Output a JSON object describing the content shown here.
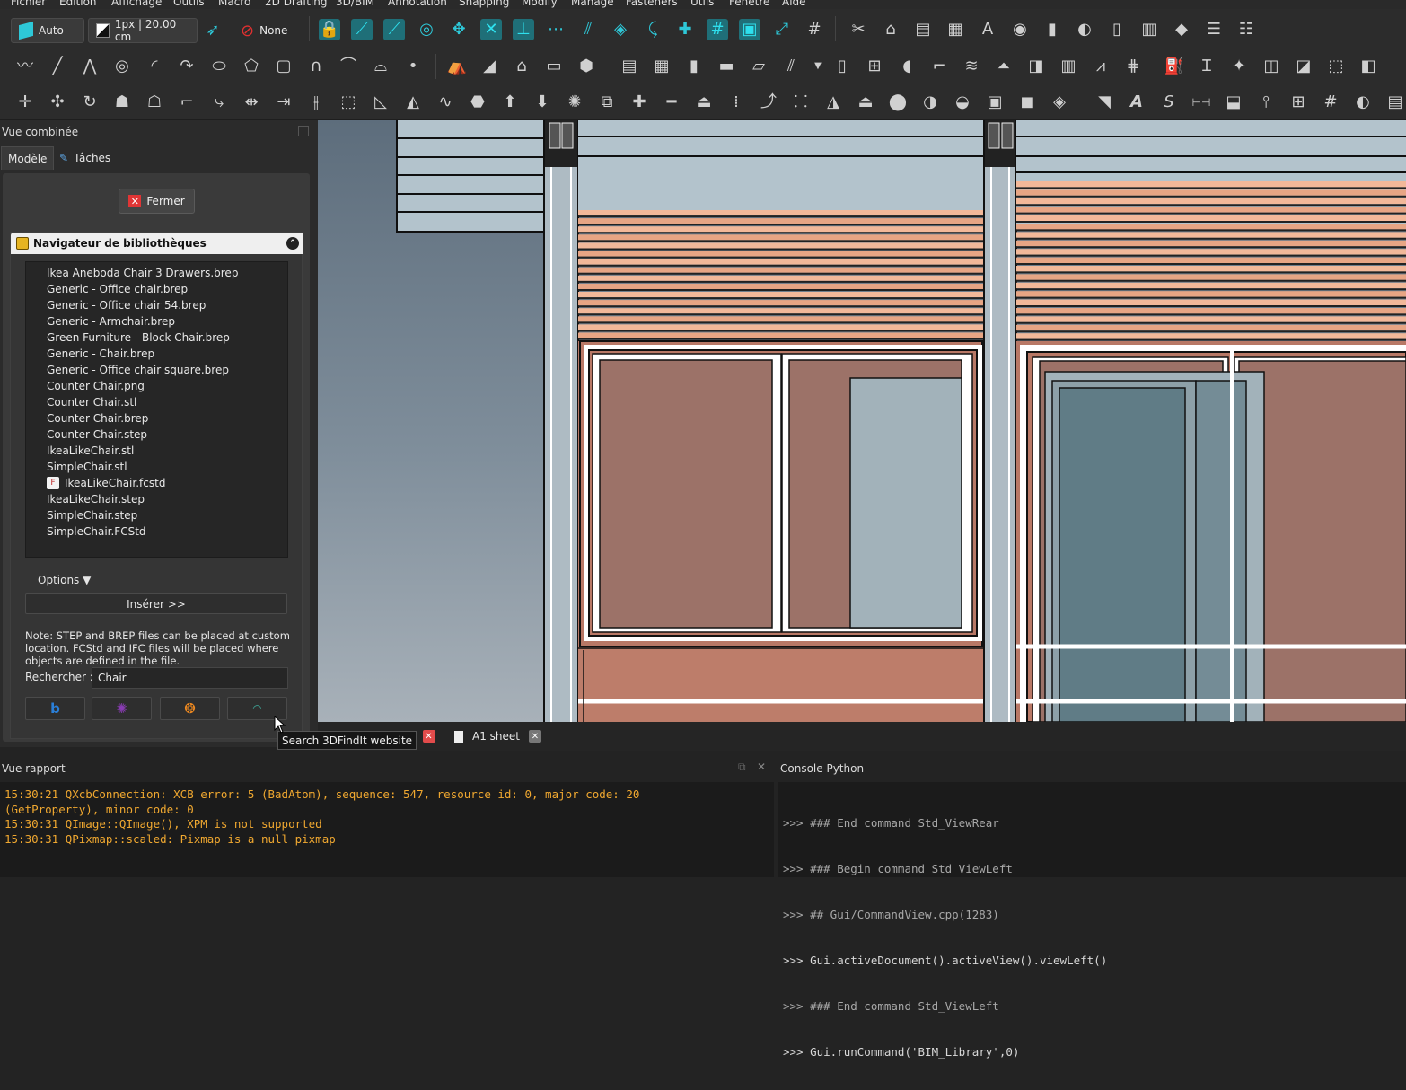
{
  "menu": [
    "Fichier",
    "Édition",
    "Affichage",
    "Outils",
    "Macro",
    "2D Drafting",
    "3D/BIM",
    "Annotation",
    "Snapping",
    "Modify",
    "Manage",
    "Fasteners",
    "Utils",
    "Fenêtre",
    "Aide"
  ],
  "toolbar": {
    "mode": "Auto",
    "line_style": "1px | 20.00 cm",
    "none_label": "None"
  },
  "left_panel": {
    "title": "Vue combinée",
    "tab_model": "Modèle",
    "tab_tasks": "Tâches",
    "close_label": "Fermer",
    "library_title": "Navigateur de bibliothèques",
    "files": [
      "Ikea Aneboda Chair 3 Drawers.brep",
      "Generic - Office chair.brep",
      "Generic - Office chair 54.brep",
      "Generic - Armchair.brep",
      "Green Furniture - Block Chair.brep",
      "Generic - Chair.brep",
      "Generic - Office chair square.brep",
      "Counter Chair.png",
      "Counter Chair.stl",
      "Counter Chair.brep",
      "Counter Chair.step",
      "IkeaLikeChair.stl",
      "SimpleChair.stl",
      "IkeaLikeChair.fcstd",
      "IkeaLikeChair.step",
      "SimpleChair.step",
      "SimpleChair.FCStd"
    ],
    "options_label": "Options ▼",
    "insert_label": "Insérer >>",
    "note": "Note: STEP and BREP files can be placed at custom location. FCStd and IFC files will be placed where objects are defined in the file.",
    "search_label": "Rechercher :",
    "search_value": "Chair"
  },
  "tooltip": "Search 3DFindIt website",
  "doc_tabs": [
    {
      "label": ": 1"
    },
    {
      "label": "A1 sheet"
    }
  ],
  "report": {
    "title": "Vue rapport",
    "lines": [
      "15:30:21  QXcbConnection: XCB error: 5 (BadAtom), sequence: 547, resource id: 0, major code: 20",
      "(GetProperty), minor code: 0",
      "15:30:31  QImage::QImage(), XPM is not supported",
      "15:30:31  QPixmap::scaled: Pixmap is a null pixmap"
    ]
  },
  "python": {
    "title": "Console Python",
    "lines": [
      ">>> ### End command Std_ViewRear",
      ">>> ### Begin command Std_ViewLeft",
      ">>> ## Gui/CommandView.cpp(1283)",
      ">>> Gui.activeDocument().activeView().viewLeft()",
      ">>> ### End command Std_ViewLeft",
      ">>> Gui.runCommand('BIM_Library',0)"
    ]
  },
  "colors": {
    "accent": "#2ec8d8",
    "brick": "#b87866",
    "glass": "#607c86",
    "frame": "#ffffff",
    "error": "#f0a830"
  }
}
